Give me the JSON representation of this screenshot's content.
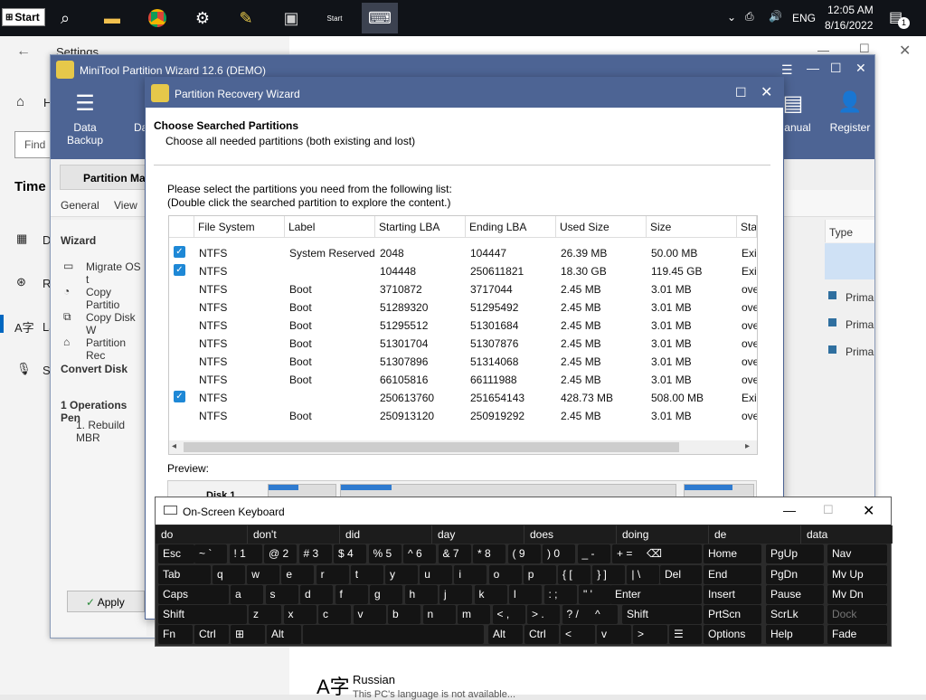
{
  "taskbar": {
    "start_label": "Start",
    "time": "12:05 AM",
    "date": "8/16/2022",
    "language": "ENG",
    "notification_count": "1"
  },
  "settings": {
    "title": "Settings",
    "home_partial": "H",
    "find_partial": "Find",
    "section_partial": "Time &",
    "nav": [
      "D",
      "R",
      "La",
      "S"
    ],
    "language_name": "Russian",
    "language_desc_partial": "This PC's language is not available..."
  },
  "minitool": {
    "title": "MiniTool Partition Wizard 12.6 (DEMO)",
    "toolbar": {
      "data_backup": "Data Backup",
      "d_partial": "Da",
      "manual": "Manual",
      "register": "Register"
    },
    "tab": "Partition Ma",
    "menu": [
      "General",
      "View"
    ],
    "wizard_header": "Wizard",
    "wizard_items": [
      "Migrate OS t",
      "Copy Partitio",
      "Copy Disk W",
      "Partition Rec"
    ],
    "convert_disk": "Convert Disk",
    "operations": "1 Operations Pen",
    "operation_item": "1. Rebuild MBR",
    "apply": "Apply",
    "type_header": "Type",
    "type_values": [
      "Prima",
      "Prima",
      "Prima"
    ]
  },
  "wizard": {
    "title": "Partition Recovery Wizard",
    "heading": "Choose Searched Partitions",
    "subheading": "Choose all needed partitions (both existing and lost)",
    "instruction1": "Please select the partitions you need from the following list:",
    "instruction2": "(Double click the searched partition to explore the content.)",
    "columns": [
      "File System",
      "Label",
      "Starting LBA",
      "Ending LBA",
      "Used Size",
      "Size",
      "Stat"
    ],
    "rows": [
      {
        "checked": true,
        "fs": "NTFS",
        "label": "System Reserved",
        "start": "2048",
        "end": "104447",
        "used": "26.39 MB",
        "size": "50.00 MB",
        "status": "Exis"
      },
      {
        "checked": true,
        "fs": "NTFS",
        "label": "",
        "start": "104448",
        "end": "250611821",
        "used": "18.30 GB",
        "size": "119.45 GB",
        "status": "Exis"
      },
      {
        "checked": false,
        "fs": "NTFS",
        "label": "Boot",
        "start": "3710872",
        "end": "3717044",
        "used": "2.45 MB",
        "size": "3.01 MB",
        "status": "ove"
      },
      {
        "checked": false,
        "fs": "NTFS",
        "label": "Boot",
        "start": "51289320",
        "end": "51295492",
        "used": "2.45 MB",
        "size": "3.01 MB",
        "status": "ove"
      },
      {
        "checked": false,
        "fs": "NTFS",
        "label": "Boot",
        "start": "51295512",
        "end": "51301684",
        "used": "2.45 MB",
        "size": "3.01 MB",
        "status": "ove"
      },
      {
        "checked": false,
        "fs": "NTFS",
        "label": "Boot",
        "start": "51301704",
        "end": "51307876",
        "used": "2.45 MB",
        "size": "3.01 MB",
        "status": "ove"
      },
      {
        "checked": false,
        "fs": "NTFS",
        "label": "Boot",
        "start": "51307896",
        "end": "51314068",
        "used": "2.45 MB",
        "size": "3.01 MB",
        "status": "ove"
      },
      {
        "checked": false,
        "fs": "NTFS",
        "label": "Boot",
        "start": "66105816",
        "end": "66111988",
        "used": "2.45 MB",
        "size": "3.01 MB",
        "status": "ove"
      },
      {
        "checked": true,
        "fs": "NTFS",
        "label": "",
        "start": "250613760",
        "end": "251654143",
        "used": "428.73 MB",
        "size": "508.00 MB",
        "status": "Exis"
      },
      {
        "checked": false,
        "fs": "NTFS",
        "label": "Boot",
        "start": "250913120",
        "end": "250919292",
        "used": "2.45 MB",
        "size": "3.01 MB",
        "status": "ove"
      }
    ],
    "preview_label": "Preview:",
    "disk_label": "Disk 1"
  },
  "keyboard": {
    "title": "On-Screen Keyboard",
    "suggestions": [
      "do",
      "don't",
      "did",
      "day",
      "does",
      "doing",
      "de",
      "data"
    ],
    "rows": [
      [
        "Esc",
        "~ `",
        "! 1",
        "@ 2",
        "# 3",
        "$ 4",
        "% 5",
        "^ 6",
        "& 7",
        "* 8",
        "( 9",
        ") 0",
        "_ -",
        "+ =",
        "⌫"
      ],
      [
        "Tab",
        "q",
        "w",
        "e",
        "r",
        "t",
        "y",
        "u",
        "i",
        "o",
        "p",
        "{ [",
        "} ]",
        "| \\",
        "Del"
      ],
      [
        "Caps",
        "a",
        "s",
        "d",
        "f",
        "g",
        "h",
        "j",
        "k",
        "l",
        ": ;",
        "\" '",
        "Enter"
      ],
      [
        "Shift",
        "z",
        "x",
        "c",
        "v",
        "b",
        "n",
        "m",
        "< ,",
        "> .",
        "? /",
        "^",
        "Shift"
      ],
      [
        "Fn",
        "Ctrl",
        "⊞",
        "Alt",
        "",
        "Alt",
        "Ctrl",
        "<",
        "v",
        ">",
        "☰"
      ]
    ],
    "nav_rows": [
      [
        "Home",
        "PgUp",
        "Nav"
      ],
      [
        "End",
        "PgDn",
        "Mv Up"
      ],
      [
        "Insert",
        "Pause",
        "Mv Dn"
      ],
      [
        "PrtScn",
        "ScrLk",
        "Dock"
      ],
      [
        "Options",
        "Help",
        "Fade"
      ]
    ]
  }
}
